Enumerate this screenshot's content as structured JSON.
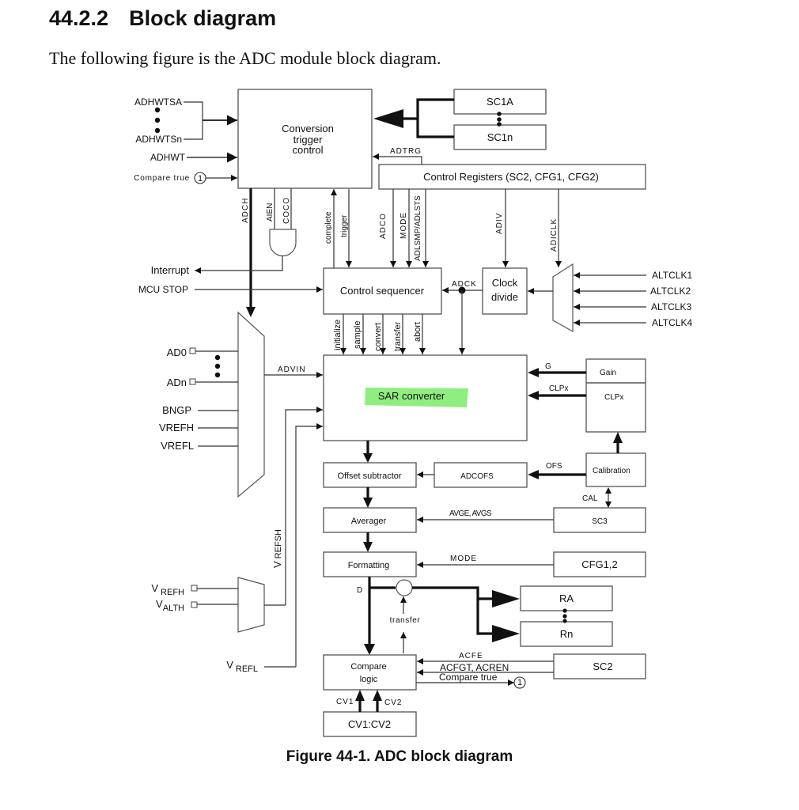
{
  "section": {
    "number": "44.2.2",
    "title": "Block diagram"
  },
  "intro": "The following figure is the ADC module block diagram.",
  "caption": "Figure 44-1. ADC block diagram",
  "highlight_color": "#90ee80",
  "blocks": {
    "conversion_trigger": [
      "Conversion",
      "trigger",
      "control"
    ],
    "sc1a": "SC1A",
    "sc1n": "SC1n",
    "control_registers": "Control Registers (SC2, CFG1, CFG2)",
    "control_sequencer": "Control sequencer",
    "clock_divide": [
      "Clock",
      "divide"
    ],
    "sar_converter": "SAR converter",
    "gain": "Gain",
    "clpx": "CLPx",
    "calibration": "Calibration",
    "offset_subtractor": "Offset subtractor",
    "adcofs": "ADCOFS",
    "averager": "Averager",
    "sc3": "SC3",
    "formatting": "Formatting",
    "cfg12": "CFG1,2",
    "ra": "RA",
    "rn": "Rn",
    "compare_logic": [
      "Compare",
      "logic"
    ],
    "sc2": "SC2",
    "cv1cv2": "CV1:CV2"
  },
  "inputs_left": {
    "adhwtsa": "ADHWTSA",
    "adhwtsn": "ADHWTSn",
    "adhwt": "ADHWT",
    "compare_true": "Compare true",
    "connector": "1",
    "interrupt": "Interrupt",
    "mcu_stop": "MCU STOP",
    "ad0": "AD0",
    "adn": "ADn",
    "bngp": "BNGP",
    "vrefh": "VREFH",
    "vrefl": "VREFL",
    "v_refh_pin": {
      "base": "V",
      "sub": "REFH"
    },
    "v_alth_pin": {
      "base": "V",
      "sub": "ALTH"
    },
    "v_refl_pin": {
      "base": "V",
      "sub": "REFL"
    }
  },
  "clocks": [
    "ALTCLK1",
    "ALTCLK2",
    "ALTCLK3",
    "ALTCLK4"
  ],
  "signals": {
    "adtrg": "ADTRG",
    "adch": "ADCH",
    "aien": "AIEN",
    "coco": "COCO",
    "complete": "complete",
    "trigger": "trigger",
    "adco": "ADCO",
    "mode": "MODE",
    "adlsmp": "ADLSMP/ADLSTS",
    "adiv": "ADIV",
    "adiclk": "ADICLK",
    "adck": "ADCK",
    "sequencer_outputs": [
      "initialize",
      "sample",
      "convert",
      "transfer",
      "abort"
    ],
    "advin": "ADVIN",
    "g": "G",
    "clpx": "CLPx",
    "ofs": "OFS",
    "cal": "CAL",
    "avge": "AVGE, AVGS",
    "mode_fmt": "MODE",
    "vrefsh": {
      "base": "V",
      "sub": "REFSH"
    },
    "d": "D",
    "transfer": "transfer",
    "acfe": "ACFE",
    "acfgt": "ACFGT, ACREN",
    "compare_true_out": "Compare true",
    "cv1": "CV1",
    "cv2": "CV2"
  }
}
